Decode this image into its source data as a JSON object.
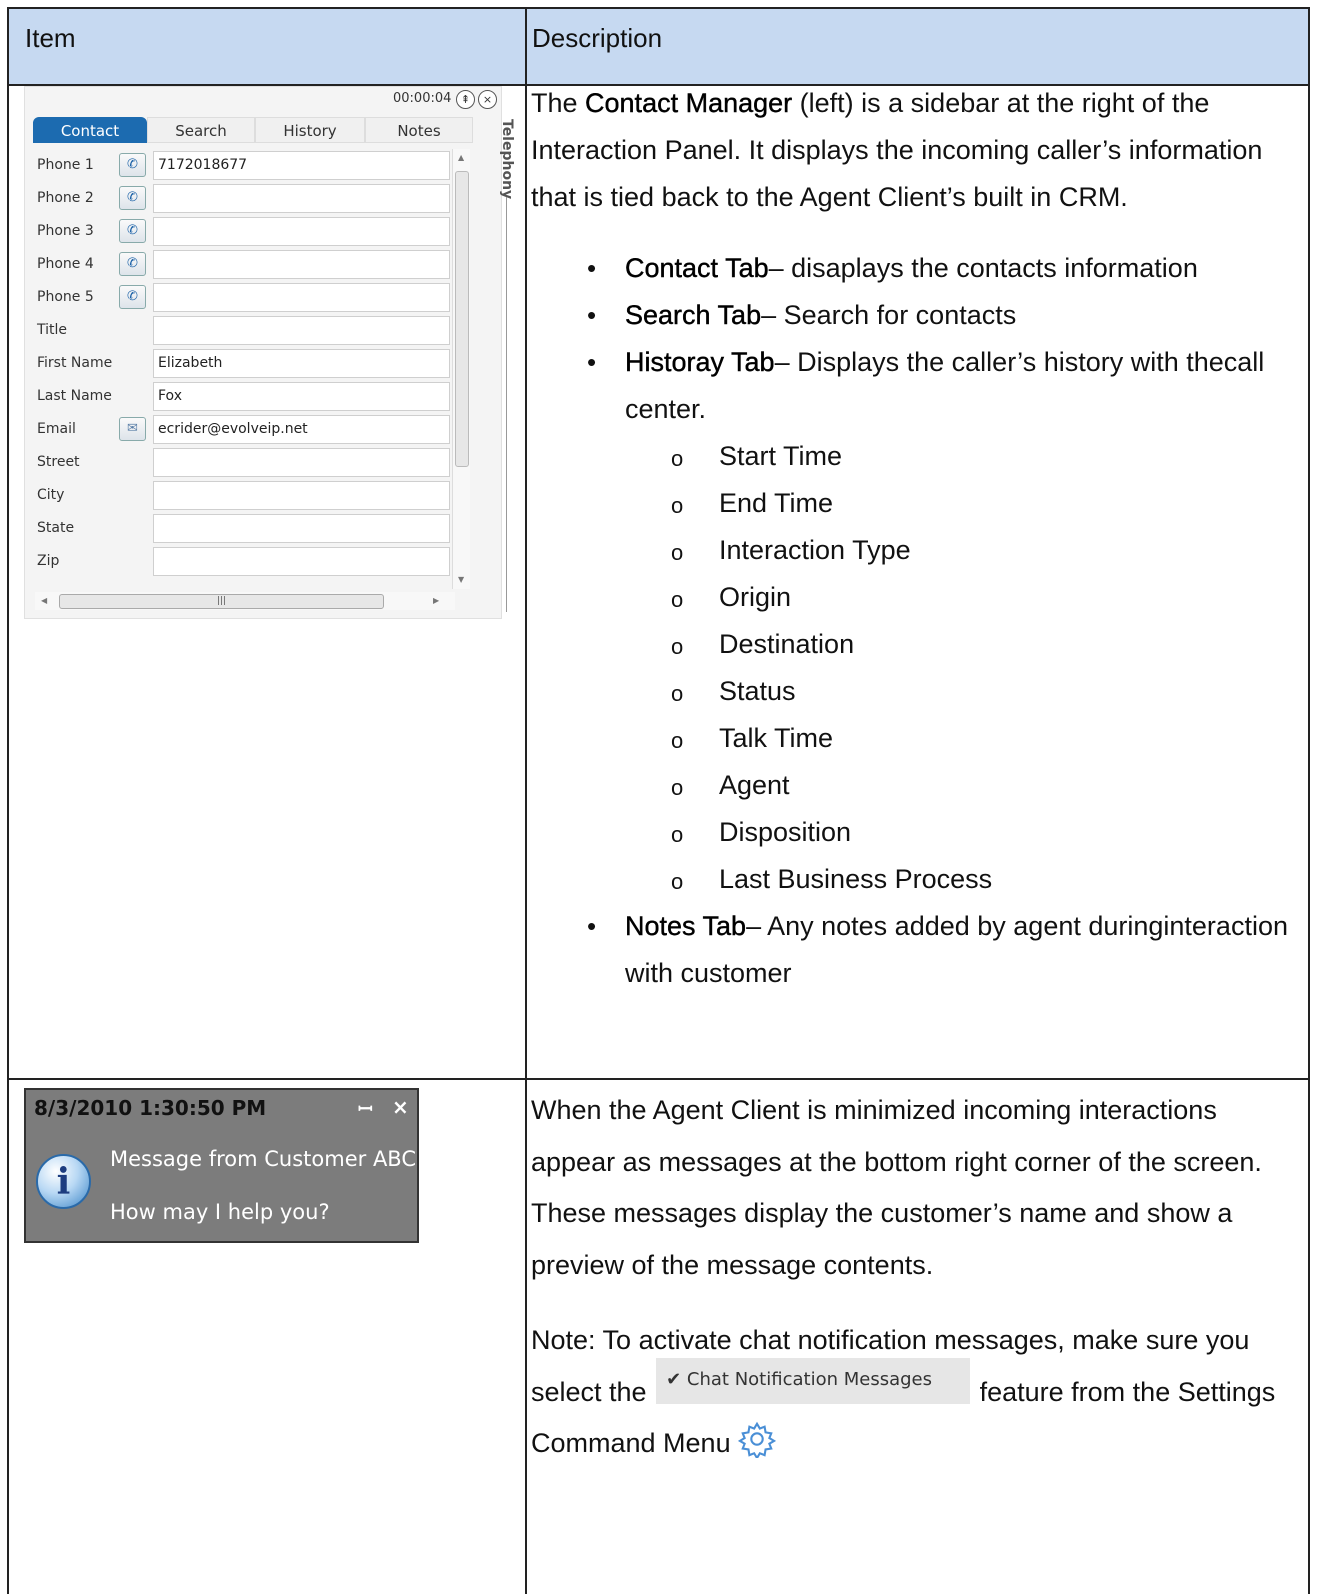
{
  "header": {
    "item": "Item",
    "description": "Description"
  },
  "contact_manager": {
    "timer": "00:00:04",
    "pin_icon": "pin-icon",
    "close_icon": "close-icon",
    "tabs": [
      "Contact",
      "Search",
      "History",
      "Notes"
    ],
    "side_tab": "Telephony",
    "fields": [
      {
        "label": "Phone 1",
        "value": "7172018677",
        "icon": "phone-icon"
      },
      {
        "label": "Phone 2",
        "value": "",
        "icon": "phone-icon"
      },
      {
        "label": "Phone 3",
        "value": "",
        "icon": "phone-icon"
      },
      {
        "label": "Phone 4",
        "value": "",
        "icon": "phone-icon"
      },
      {
        "label": "Phone 5",
        "value": "",
        "icon": "phone-icon"
      },
      {
        "label": "Title",
        "value": ""
      },
      {
        "label": "First Name",
        "value": "Elizabeth"
      },
      {
        "label": "Last Name",
        "value": "Fox"
      },
      {
        "label": "Email",
        "value": "ecrider@evolveip.net",
        "icon": "email-icon"
      },
      {
        "label": "Street",
        "value": ""
      },
      {
        "label": "City",
        "value": ""
      },
      {
        "label": "State",
        "value": ""
      },
      {
        "label": "Zip",
        "value": ""
      }
    ]
  },
  "row1": {
    "intro_pre": "The ",
    "intro_bold": "Contact Manager",
    "intro_post": " (left) is a sidebar at the right of the Interaction Panel. It displays the incoming caller’s information that is tied back to the Agent Client’s built in CRM.",
    "bullets": [
      {
        "bold": "Contact Tab",
        "text": "– disaplays the contacts information"
      },
      {
        "bold": "Search  Tab",
        "text": "– Search for contacts"
      },
      {
        "bold": "Historay Tab",
        "text": "– Displays the caller’s history with thecall center."
      },
      {
        "bold": "Notes Tab",
        "text": "– Any notes added by agent duringinteraction with customer"
      }
    ],
    "history_items": [
      "Start Time",
      "End Time",
      "Interaction Type",
      "Origin",
      "Destination",
      "Status",
      "Talk Time",
      "Agent",
      "Disposition",
      "Last Business Process"
    ]
  },
  "notification": {
    "datetime": "8/3/2010 1:30:50 PM",
    "line1": "Message from Customer ABC",
    "line2": "How may I help you?"
  },
  "row2": {
    "para1": "When the Agent Client is minimized incoming interactions appear as messages at the bottom right corner of the screen. These messages display the customer’s name and show a preview of the message contents.",
    "note_pre": "Note: To activate chat notification messages, make sure you select the",
    "chip_label": "Chat Notification Messages",
    "note_mid": "feature from the Settings Command Menu"
  }
}
